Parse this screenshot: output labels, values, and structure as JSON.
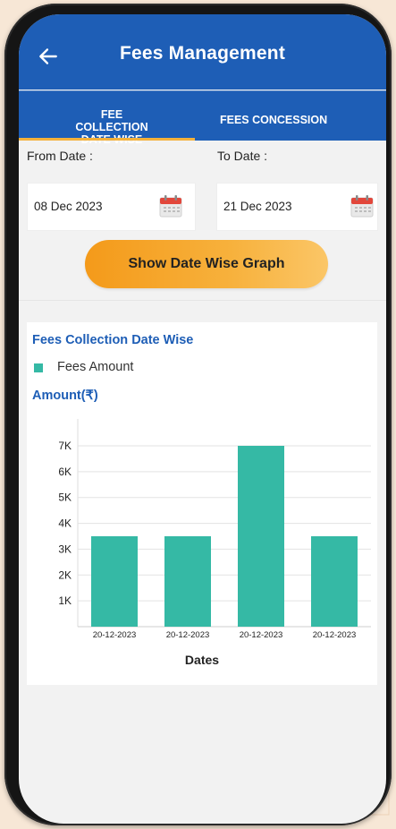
{
  "header": {
    "title": "Fees Management",
    "back_icon": "back-arrow-icon"
  },
  "tabs": [
    {
      "label": "FEE COLLECTION DATE WISE",
      "active": true
    },
    {
      "label": "FEES CONCESSION",
      "active": false
    }
  ],
  "filters": {
    "from_label": "From Date :",
    "from_value": "08 Dec 2023",
    "to_label": "To Date :",
    "to_value": "21 Dec 2023",
    "calendar_icon": "calendar-icon"
  },
  "button": {
    "label": "Show Date Wise Graph"
  },
  "chart_card": {
    "title": "Fees Collection Date Wise",
    "legend": "Fees Amount",
    "y_axis_title": "Amount(₹)",
    "x_axis_title": "Dates"
  },
  "colors": {
    "primary": "#1e5eb6",
    "accent": "#f4b13a",
    "bar": "#35b9a5"
  },
  "chart_data": {
    "type": "bar",
    "categories": [
      "20-12-2023",
      "20-12-2023",
      "20-12-2023",
      "20-12-2023"
    ],
    "series": [
      {
        "name": "Fees Amount",
        "values": [
          3500,
          3500,
          7000,
          3500
        ]
      }
    ],
    "ylim": [
      0,
      7000
    ],
    "yticks": [
      1000,
      2000,
      3000,
      4000,
      5000,
      6000,
      7000
    ],
    "ytick_labels": [
      "1K",
      "2K",
      "3K",
      "4K",
      "5K",
      "6K",
      "7K"
    ],
    "xlabel": "Dates",
    "ylabel": "Amount(₹)",
    "grid": "horizontal",
    "legend": "top-left"
  }
}
